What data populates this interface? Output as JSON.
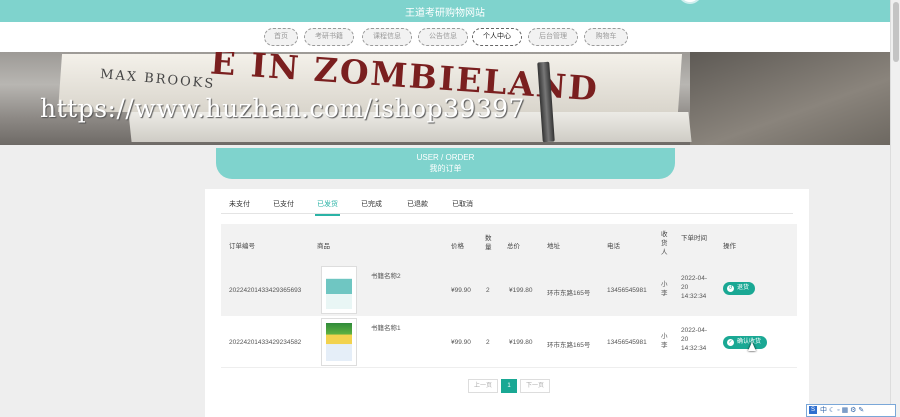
{
  "header": {
    "site_title": "王道考研购物网站"
  },
  "nav": {
    "items": [
      {
        "label": "首页"
      },
      {
        "label": "考研书籍"
      },
      {
        "label": "课程信息"
      },
      {
        "label": "公告信息"
      },
      {
        "label": "个人中心",
        "active": true
      },
      {
        "label": "后台管理"
      },
      {
        "label": "购物车"
      }
    ]
  },
  "banner": {
    "book_title": "E IN ZOMBIELAND",
    "book_author": "MAX BROOKS",
    "watermark": "https://www.huzhan.com/ishop39397"
  },
  "section": {
    "title_en": "USER / ORDER",
    "title_zh": "我的订单"
  },
  "tabs": [
    {
      "label": "未支付"
    },
    {
      "label": "已支付"
    },
    {
      "label": "已发货",
      "active": true
    },
    {
      "label": "已完成"
    },
    {
      "label": "已退款"
    },
    {
      "label": "已取消"
    }
  ],
  "table": {
    "headers": {
      "order_no": "订单编号",
      "product": "商品",
      "price": "价格",
      "qty": "数量",
      "total": "总价",
      "address": "地址",
      "phone": "电话",
      "receiver": "收货人",
      "time": "下单时间",
      "action": "操作"
    },
    "rows": [
      {
        "order_no": "20224201433429365693",
        "product_name": "书籍名称2",
        "price": "¥99.90",
        "qty": "2",
        "total": "¥199.80",
        "address": "环市东路165号",
        "phone": "13456545981",
        "receiver": "小李",
        "time": "2022-04-20 14:32:34",
        "action": "退货"
      },
      {
        "order_no": "20224201433429234582",
        "product_name": "书籍名称1",
        "price": "¥99.90",
        "qty": "2",
        "total": "¥199.80",
        "address": "环市东路165号",
        "phone": "13456545981",
        "receiver": "小李",
        "time": "2022-04-20 14:32:34",
        "action": "确认收货"
      }
    ]
  },
  "pagination": {
    "prev": "上一页",
    "current": "1",
    "next": "下一页"
  },
  "ime": {
    "label": "中"
  }
}
